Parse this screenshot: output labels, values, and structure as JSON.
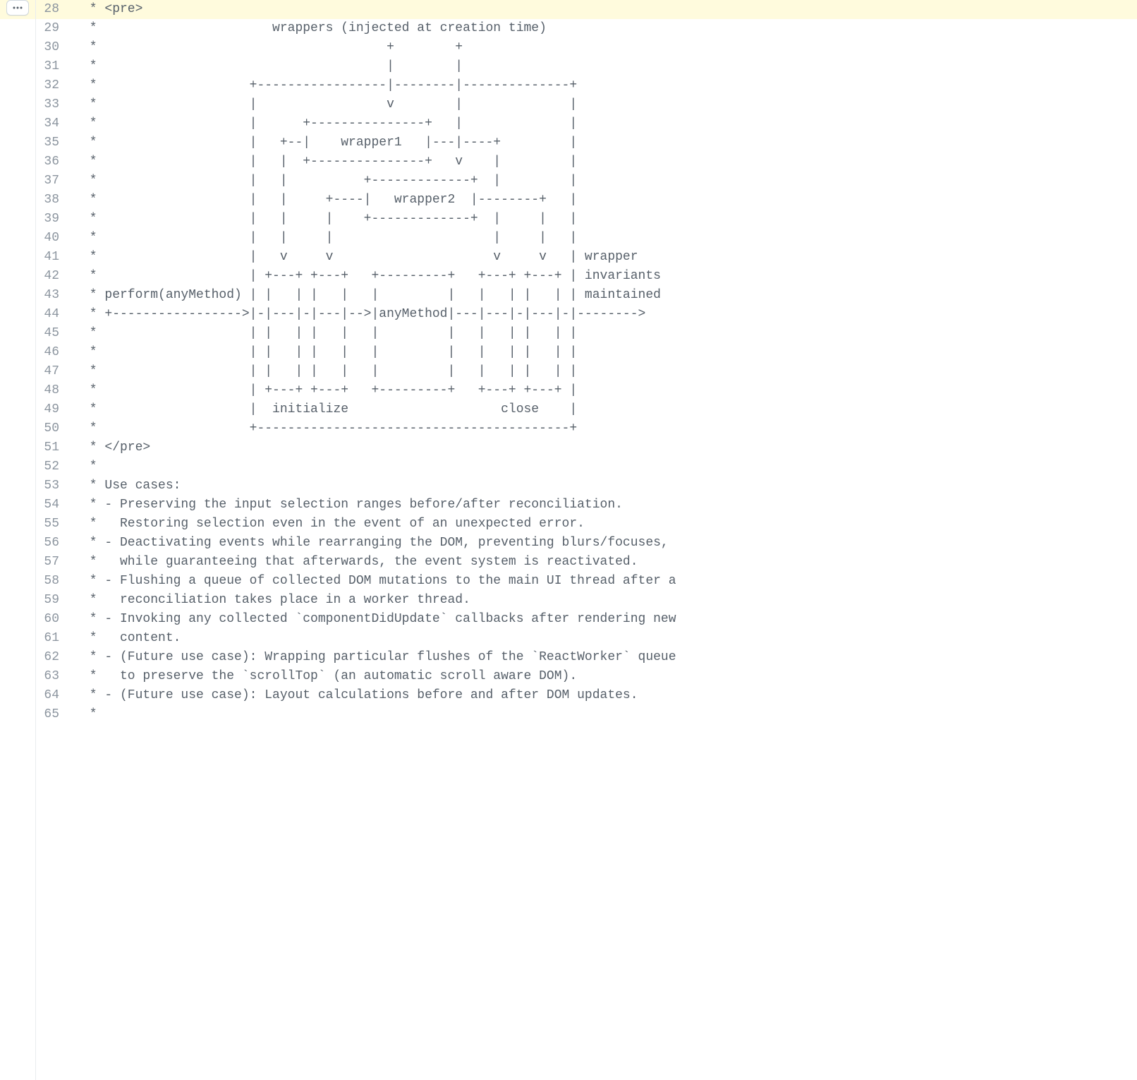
{
  "startLine": 28,
  "highlightLine": 28,
  "lines": [
    " * <pre>",
    " *                       wrappers (injected at creation time)",
    " *                                      +        +",
    " *                                      |        |",
    " *                    +-----------------|--------|--------------+",
    " *                    |                 v        |              |",
    " *                    |      +---------------+   |              |",
    " *                    |   +--|    wrapper1   |---|----+         |",
    " *                    |   |  +---------------+   v    |         |",
    " *                    |   |          +-------------+  |         |",
    " *                    |   |     +----|   wrapper2  |--------+   |",
    " *                    |   |     |    +-------------+  |     |   |",
    " *                    |   |     |                     |     |   |",
    " *                    |   v     v                     v     v   | wrapper",
    " *                    | +---+ +---+   +---------+   +---+ +---+ | invariants",
    " * perform(anyMethod) | |   | |   |   |         |   |   | |   | | maintained",
    " * +----------------->|-|---|-|---|-->|anyMethod|---|---|-|---|-|-------->",
    " *                    | |   | |   |   |         |   |   | |   | |",
    " *                    | |   | |   |   |         |   |   | |   | |",
    " *                    | |   | |   |   |         |   |   | |   | |",
    " *                    | +---+ +---+   +---------+   +---+ +---+ |",
    " *                    |  initialize                    close    |",
    " *                    +-----------------------------------------+",
    " * </pre>",
    " *",
    " * Use cases:",
    " * - Preserving the input selection ranges before/after reconciliation.",
    " *   Restoring selection even in the event of an unexpected error.",
    " * - Deactivating events while rearranging the DOM, preventing blurs/focuses,",
    " *   while guaranteeing that afterwards, the event system is reactivated.",
    " * - Flushing a queue of collected DOM mutations to the main UI thread after a",
    " *   reconciliation takes place in a worker thread.",
    " * - Invoking any collected `componentDidUpdate` callbacks after rendering new",
    " *   content.",
    " * - (Future use case): Wrapping particular flushes of the `ReactWorker` queue",
    " *   to preserve the `scrollTop` (an automatic scroll aware DOM).",
    " * - (Future use case): Layout calculations before and after DOM updates.",
    " *"
  ]
}
